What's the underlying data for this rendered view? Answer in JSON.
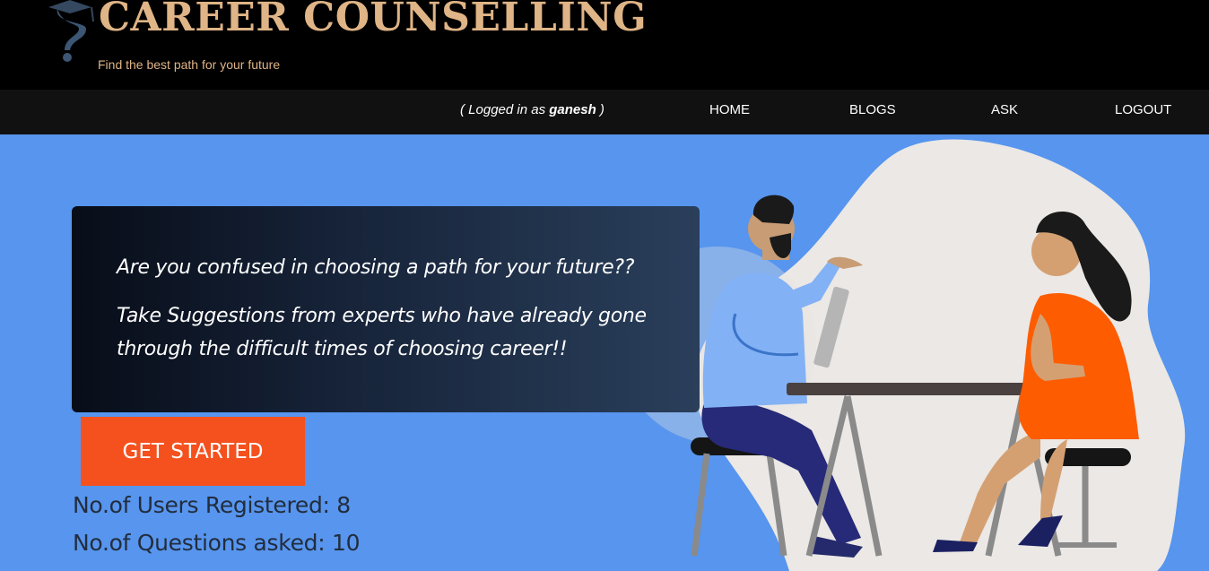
{
  "header": {
    "title": "CAREER COUNSELLING",
    "tagline": "Find the best path for your future",
    "logo_icon": "question-mark-graduation-cap-icon"
  },
  "nav": {
    "login_prefix": "( Logged in as ",
    "username": "ganesh",
    "login_suffix": " )",
    "links": [
      "HOME",
      "BLOGS",
      "ASK",
      "LOGOUT"
    ]
  },
  "hero": {
    "line1": "Are you confused in choosing a path for your future??",
    "line2": "Take Suggestions from experts who have already gone",
    "line3": "through the difficult times of choosing career!!",
    "cta_label": "GET STARTED"
  },
  "stats": {
    "users_label": "No.of Users Registered: 8",
    "questions_label": "No.of Questions asked: 10"
  },
  "colors": {
    "background": "#5795ee",
    "title": "#dfb486",
    "cta": "#f4511e"
  }
}
